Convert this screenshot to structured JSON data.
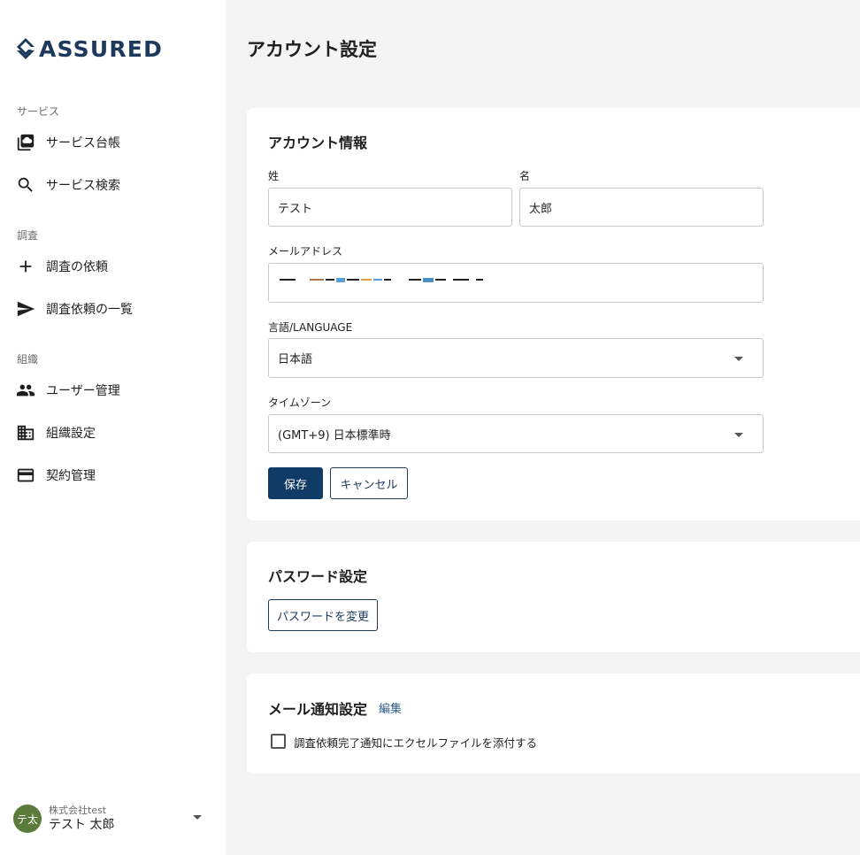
{
  "brand": {
    "name": "ASSURED",
    "color": "#1d3a5c"
  },
  "sidebar": {
    "sections": [
      {
        "label": "サービス",
        "items": [
          {
            "label": "サービス台帳",
            "icon": "service-ledger-icon"
          },
          {
            "label": "サービス検索",
            "icon": "search-icon"
          }
        ]
      },
      {
        "label": "調査",
        "items": [
          {
            "label": "調査の依頼",
            "icon": "plus-icon"
          },
          {
            "label": "調査依頼の一覧",
            "icon": "send-icon"
          }
        ]
      },
      {
        "label": "組織",
        "items": [
          {
            "label": "ユーザー管理",
            "icon": "people-icon"
          },
          {
            "label": "組織設定",
            "icon": "building-icon"
          },
          {
            "label": "契約管理",
            "icon": "credit-card-icon"
          }
        ]
      }
    ],
    "user": {
      "avatar_text": "テ太",
      "avatar_color": "#5b7b3a",
      "org": "株式会社test",
      "name": "テスト 太郎"
    }
  },
  "main": {
    "page_title": "アカウント設定",
    "account_info": {
      "title": "アカウント情報",
      "last_name_label": "姓",
      "last_name_value": "テスト",
      "first_name_label": "名",
      "first_name_value": "太郎",
      "email_label": "メールアドレス",
      "language_label": "言語/LANGUAGE",
      "language_value": "日本語",
      "timezone_label": "タイムゾーン",
      "timezone_value": "(GMT+9) 日本標準時",
      "save_label": "保存",
      "cancel_label": "キャンセル"
    },
    "password": {
      "title": "パスワード設定",
      "change_label": "パスワードを変更"
    },
    "notifications": {
      "title": "メール通知設定",
      "edit_label": "編集",
      "checkbox_label": "調査依頼完了通知にエクセルファイルを添付する",
      "checked": false
    },
    "colors": {
      "primary": "#0f3b66",
      "link": "#2f5d8a",
      "background": "#f4f4f4"
    }
  }
}
